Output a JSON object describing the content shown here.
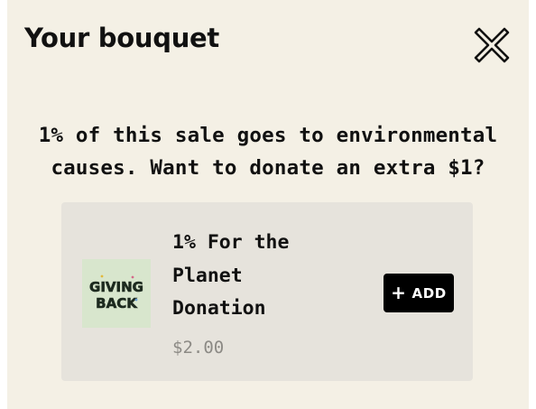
{
  "panel": {
    "title": "Your bouquet",
    "close_icon": "close-icon"
  },
  "message": {
    "line1": "1% of this sale goes to environmental",
    "line2": "causes. Want to donate an extra $1?"
  },
  "donation_card": {
    "thumbnail_text": {
      "line1": "GIVING",
      "line2": "BACK"
    },
    "name_lines": [
      "1% For the",
      "Planet",
      "Donation"
    ],
    "price": "$2.00",
    "add_button": {
      "icon": "plus-icon",
      "label": "ADD"
    }
  },
  "colors": {
    "panel_bg": "#f4f0e5",
    "card_bg": "#e6e3dc",
    "thumbnail_bg": "#d8e6cd",
    "button_bg": "#000000",
    "price_text": "#8c8a85"
  }
}
